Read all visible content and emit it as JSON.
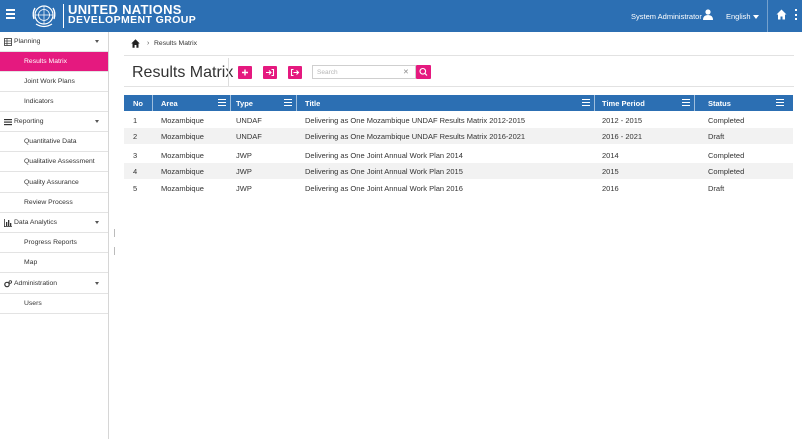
{
  "header": {
    "org_line1": "UNITED NATIONS",
    "org_line2": "DEVELOPMENT GROUP",
    "user_label": "System Administrator",
    "language": "English"
  },
  "sidebar": {
    "sections": [
      {
        "label": "Planning",
        "items": [
          "Results Matrix",
          "Joint Work Plans",
          "Indicators"
        ]
      },
      {
        "label": "Reporting",
        "items": [
          "Quantitative Data",
          "Qualitative Assessment",
          "Quality Assurance",
          "Review Process"
        ]
      },
      {
        "label": "Data Analytics",
        "items": [
          "Progress Reports",
          "Map"
        ]
      },
      {
        "label": "Administration",
        "items": [
          "Users"
        ]
      }
    ],
    "active_item": "Results Matrix"
  },
  "breadcrumb": {
    "current": "Results Matrix"
  },
  "page": {
    "title": "Results Matrix"
  },
  "search": {
    "placeholder": "Search",
    "value": ""
  },
  "table": {
    "columns": [
      "No",
      "Area",
      "Type",
      "Title",
      "Time Period",
      "Status"
    ],
    "rows": [
      [
        "1",
        "Mozambique",
        "UNDAF",
        "Delivering as One Mozambique UNDAF Results Matrix 2012-2015",
        "2012 - 2015",
        "Completed"
      ],
      [
        "2",
        "Mozambique",
        "UNDAF",
        "Delivering as One Mozambique UNDAF Results Matrix 2016-2021",
        "2016 - 2021",
        "Draft"
      ],
      [
        "3",
        "Mozambique",
        "JWP",
        "Delivering as One Joint Annual Work Plan 2014",
        "2014",
        "Completed"
      ],
      [
        "4",
        "Mozambique",
        "JWP",
        "Delivering as One Joint Annual Work Plan 2015",
        "2015",
        "Completed"
      ],
      [
        "5",
        "Mozambique",
        "JWP",
        "Delivering as One Joint Annual Work Plan 2016",
        "2016",
        "Draft"
      ]
    ]
  },
  "colors": {
    "header_blue": "#2c6fb3",
    "accent_pink": "#e5197f",
    "row_alt": "#f2f2f2"
  },
  "icons": [
    "menu-icon",
    "un-emblem-icon",
    "user-icon",
    "home-icon",
    "more-vertical-icon",
    "plus-icon",
    "import-icon",
    "export-icon",
    "search-icon",
    "clear-icon",
    "column-menu-icon"
  ]
}
